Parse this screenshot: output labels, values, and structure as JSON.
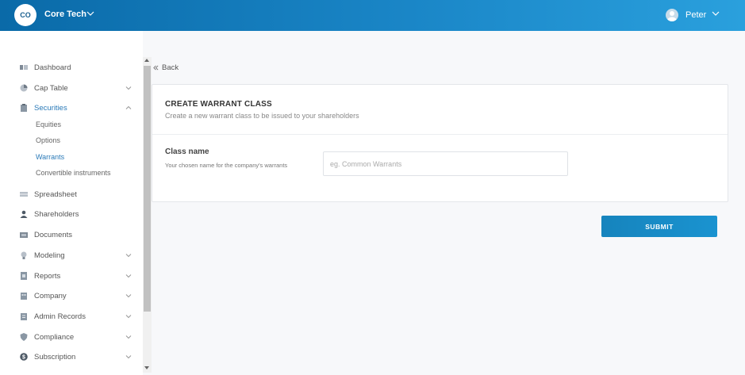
{
  "header": {
    "org_initials": "CO",
    "org_name": "Core Tech",
    "user_name": "Peter"
  },
  "sidebar": {
    "items": [
      {
        "label": "Dashboard",
        "icon": "dashboard-icon"
      },
      {
        "label": "Cap Table",
        "icon": "pie-chart-icon"
      },
      {
        "label": "Securities",
        "icon": "clipboard-icon"
      },
      {
        "label": "Spreadsheet",
        "icon": "spreadsheet-icon"
      },
      {
        "label": "Shareholders",
        "icon": "person-icon"
      },
      {
        "label": "Documents",
        "icon": "folder-icon"
      },
      {
        "label": "Modeling",
        "icon": "lightbulb-icon"
      },
      {
        "label": "Reports",
        "icon": "report-icon"
      },
      {
        "label": "Company",
        "icon": "company-icon"
      },
      {
        "label": "Admin Records",
        "icon": "records-icon"
      },
      {
        "label": "Compliance",
        "icon": "shield-icon"
      },
      {
        "label": "Subscription",
        "icon": "dollar-icon"
      }
    ],
    "securities_sub": [
      "Equities",
      "Options",
      "Warrants",
      "Convertible instruments"
    ]
  },
  "main": {
    "back_label": "Back",
    "card_title": "CREATE WARRANT CLASS",
    "card_subtitle": "Create a new warrant class to be issued to your shareholders",
    "field_label": "Class name",
    "field_help": "Your chosen name for the company's warrants",
    "field_placeholder": "eg. Common Warrants",
    "field_value": "",
    "submit_label": "SUBMIT"
  },
  "colors": {
    "header_gradient_start": "#0a6aa8",
    "header_gradient_end": "#2aa0dd",
    "accent": "#2a7ab8",
    "submit_button": "#1684bd"
  }
}
